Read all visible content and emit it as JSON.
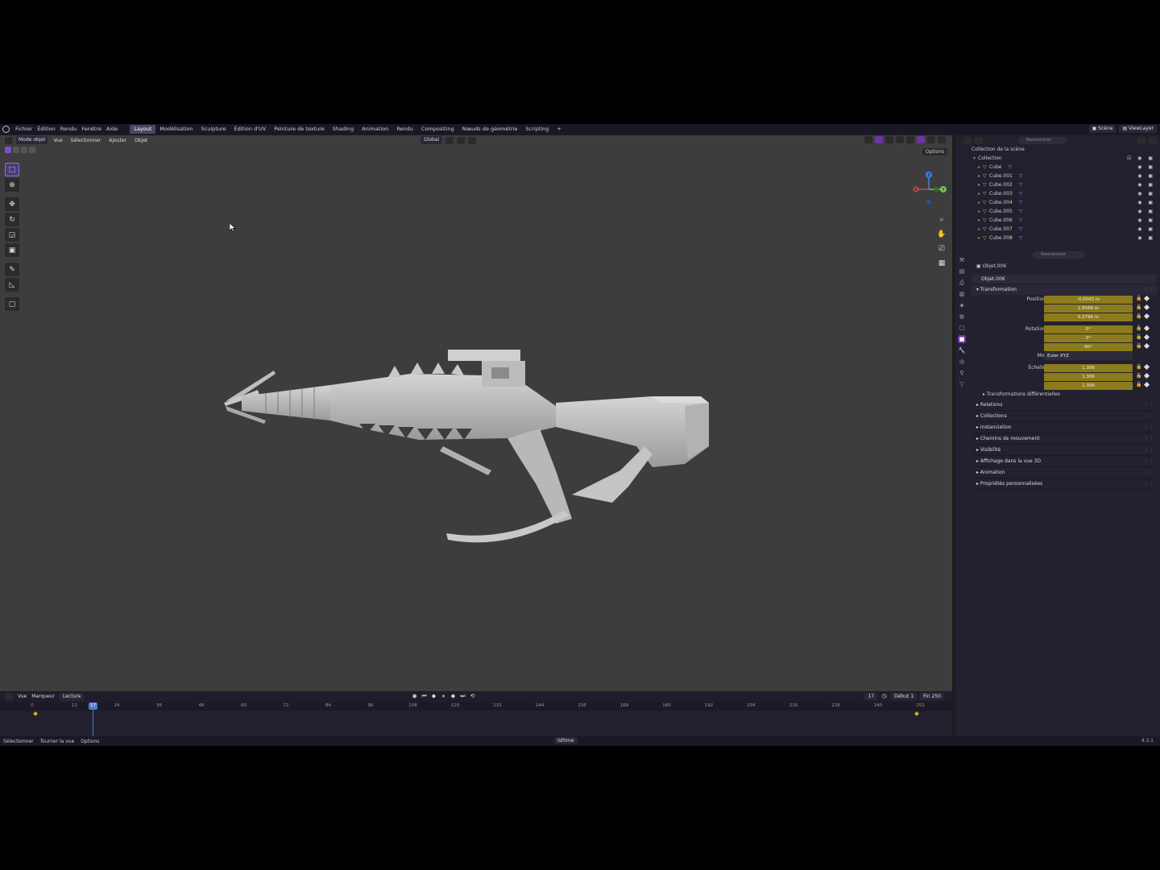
{
  "menu": {
    "items": [
      "Fichier",
      "Édition",
      "Rendu",
      "Fenêtre",
      "Aide"
    ],
    "workspaces": [
      "Layout",
      "Modélisation",
      "Sculpture",
      "Édition d'UV",
      "Peinture de texture",
      "Shading",
      "Animation",
      "Rendu",
      "Compositing",
      "Nœuds de géométrie",
      "Scripting"
    ],
    "active_workspace": "Layout",
    "add_tab": "+",
    "scene": "Scène",
    "view_layer": "ViewLayer"
  },
  "viewport": {
    "mode": "Mode objet",
    "menus": [
      "Vue",
      "Sélectionner",
      "Ajouter",
      "Objet"
    ],
    "orientation": "Global",
    "options": "Options"
  },
  "gizmo": {
    "x": "X",
    "y": "Y",
    "z": "Z"
  },
  "timeline": {
    "menus": [
      "Vue",
      "Marqueur"
    ],
    "playback": "Lecture",
    "current_frame": "17",
    "start_label": "Début",
    "start": "1",
    "end_label": "Fin",
    "end": "250",
    "ticks": [
      "0",
      "12",
      "24",
      "36",
      "48",
      "60",
      "72",
      "84",
      "96",
      "108",
      "120",
      "132",
      "144",
      "156",
      "168",
      "180",
      "192",
      "204",
      "216",
      "228",
      "240",
      "252"
    ]
  },
  "statusbar": {
    "items": [
      "Sélectionner",
      "Tourner la vue",
      "Options"
    ],
    "center": "Isthme",
    "version": "4.3.1"
  },
  "outliner": {
    "search_placeholder": "Rechercher",
    "title": "Collection de la scène",
    "collection": "Collection",
    "objects": [
      "Cube",
      "Cube.001",
      "Cube.002",
      "Cube.003",
      "Cube.004",
      "Cube.005",
      "Cube.006",
      "Cube.007",
      "Cube.008"
    ]
  },
  "properties": {
    "search_placeholder": "Rechercher",
    "breadcrumb": "Objet.006",
    "object_name": "Objet.006",
    "transform_header": "Transformation",
    "location_label": "Position X",
    "location": [
      "-0.0043 m",
      "2.9568 m",
      "0.2796 m"
    ],
    "rotation_label": "Rotation X",
    "rotation": [
      "0°",
      "0°",
      "90°"
    ],
    "mode_label": "Mode",
    "mode_value": "Euler XYZ",
    "scale_label": "Échelle X",
    "scale": [
      "1.306",
      "1.306",
      "1.306"
    ],
    "axis_y": "Y",
    "axis_z": "Z",
    "delta": "Transformations différentielles",
    "sections": [
      "Relations",
      "Collections",
      "Instanciation",
      "Chemins de mouvement",
      "Visibilité",
      "Affichage dans la vue 3D",
      "Animation",
      "Propriétés personnalisées"
    ]
  },
  "colors": {
    "accent": "#6a35a8",
    "keyframe": "#8c7b1c",
    "playhead": "#4f7ad6"
  }
}
